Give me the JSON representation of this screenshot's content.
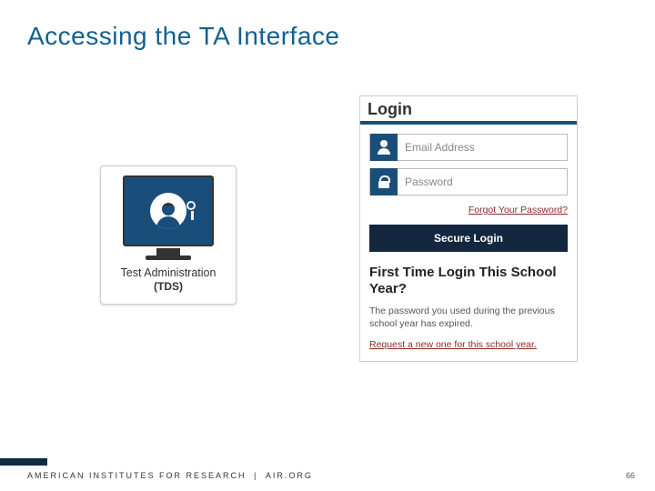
{
  "slide": {
    "title": "Accessing the TA Interface"
  },
  "ta_card": {
    "label": "Test Administration",
    "sub": "(TDS)"
  },
  "login": {
    "heading": "Login",
    "email_placeholder": "Email Address",
    "password_placeholder": "Password",
    "forgot": "Forgot Your Password?",
    "secure_login": "Secure Login",
    "first_time_heading": "First Time Login This School Year?",
    "expired_text": "The password you used during the previous school year has expired.",
    "request_link": "Request a new one for this school year."
  },
  "footer": {
    "org": "AMERICAN INSTITUTES FOR RESEARCH",
    "sep": " | ",
    "site": "AIR.ORG",
    "page": "66"
  }
}
